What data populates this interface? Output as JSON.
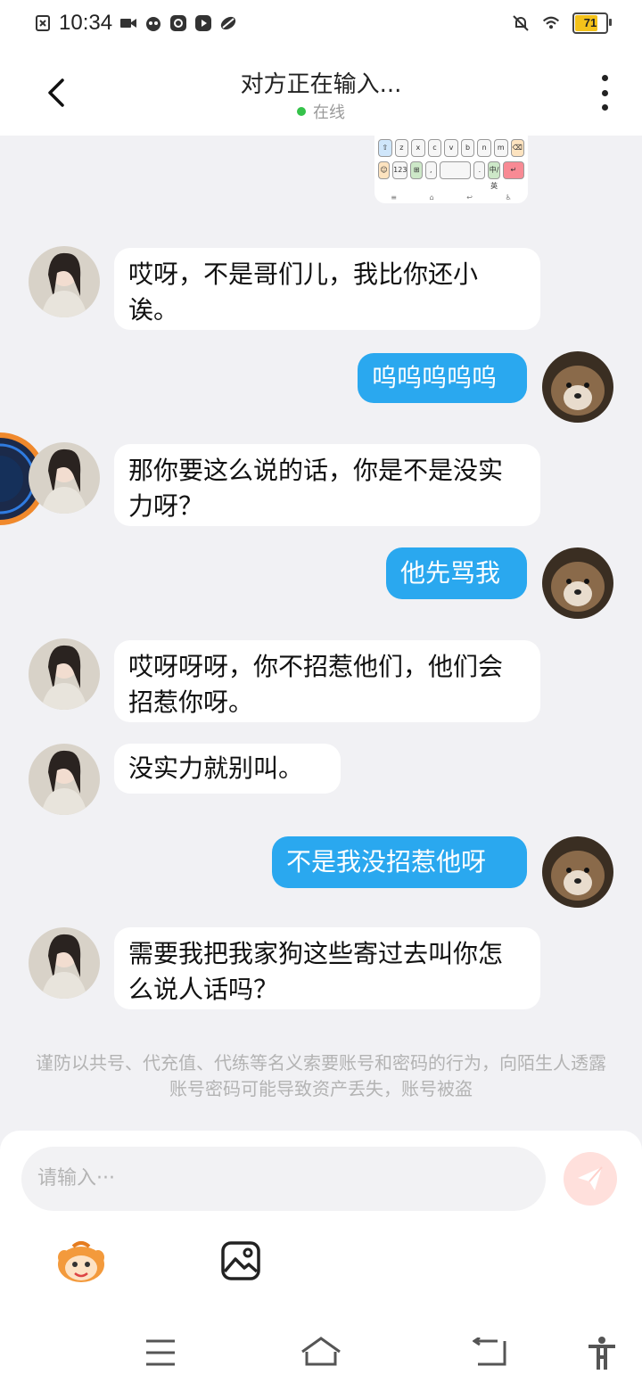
{
  "status_bar": {
    "time": "10:34",
    "battery_level": "71",
    "icons": [
      "sim-x-icon",
      "video-icon",
      "app-icon",
      "at-icon",
      "play-icon",
      "leaf-icon",
      "mute-icon",
      "wifi-icon",
      "battery-icon"
    ]
  },
  "header": {
    "title": "对方正在输入...",
    "status": "在线"
  },
  "image_message": {
    "keys_row1": [
      "⇧",
      "z",
      "x",
      "c",
      "v",
      "b",
      "n",
      "m",
      "⌫"
    ],
    "keys_row2": [
      "☺",
      "123",
      "⊞",
      ",",
      "",
      ".",
      "中/英",
      "↵"
    ]
  },
  "messages": [
    {
      "from": "them",
      "text": "哎呀，不是哥们儿，我比你还小诶。"
    },
    {
      "from": "me",
      "text": "呜呜呜呜呜"
    },
    {
      "from": "them",
      "text": "那你要这么说的话，你是不是没实力呀？"
    },
    {
      "from": "me",
      "text": "他先骂我"
    },
    {
      "from": "them",
      "text": "哎呀呀呀，你不招惹他们，他们会招惹你呀。"
    },
    {
      "from": "them",
      "text": "没实力就别叫。"
    },
    {
      "from": "me",
      "text": "不是我没招惹他呀"
    },
    {
      "from": "them",
      "text": "需要我把我家狗这些寄过去叫你怎么说人话吗？"
    }
  ],
  "notice": "谨防以共号、代充值、代练等名义索要账号和密码的行为，向陌生人透露账号密码可能导致资产丢失，账号被盗",
  "composer": {
    "placeholder": "请输入···"
  },
  "colors": {
    "outgoing_bubble": "#2aa8ef",
    "incoming_bubble": "#ffffff",
    "online_dot": "#35c24a",
    "send_button": "#ffe0dc"
  }
}
